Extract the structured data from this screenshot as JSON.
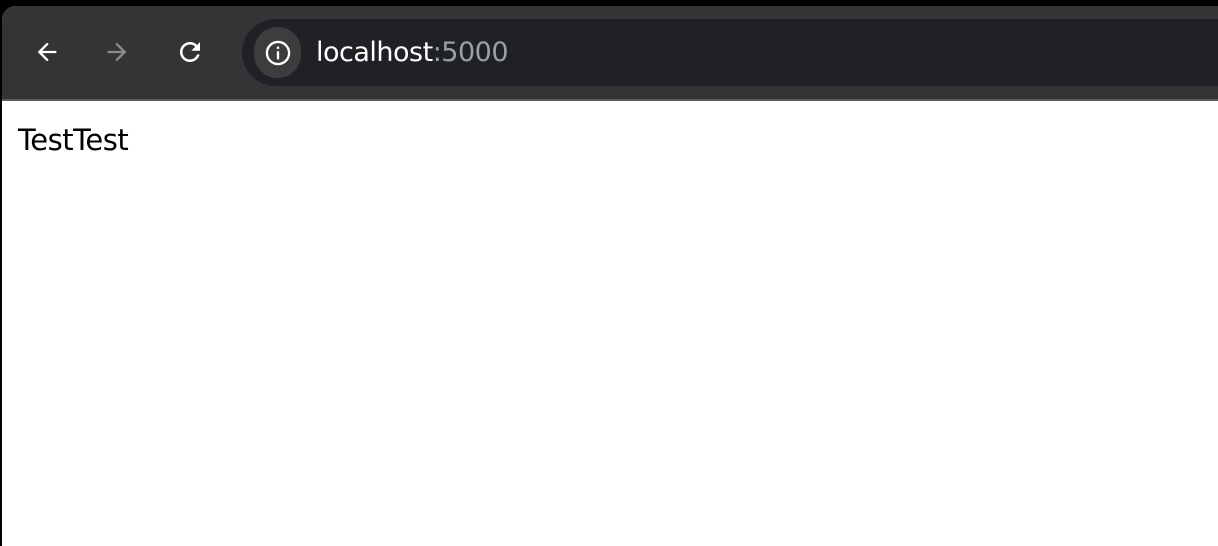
{
  "browser": {
    "toolbar": {
      "back_icon": "arrow-left-icon",
      "forward_icon": "arrow-right-icon",
      "reload_icon": "reload-icon",
      "forward_enabled": false
    },
    "omnibox": {
      "site_info_icon": "info-icon",
      "host": "localhost",
      "port": ":5000"
    }
  },
  "page": {
    "text": "TestTest"
  },
  "colors": {
    "toolbar_bg": "#323436",
    "omnibox_bg": "#202124",
    "host_text": "#ffffff",
    "port_text": "#9aa0a6",
    "page_bg": "#ffffff"
  }
}
